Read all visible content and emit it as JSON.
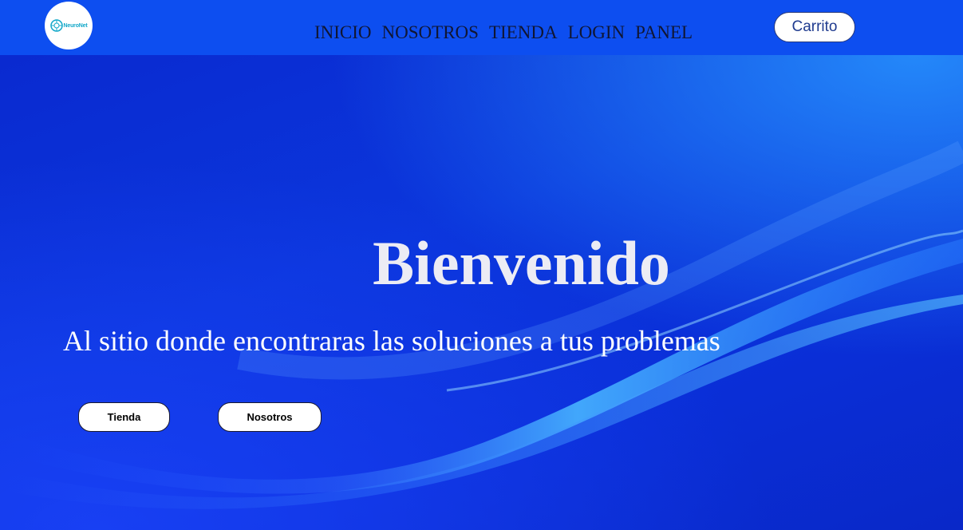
{
  "header": {
    "logo_text": "NeuroNet",
    "nav": [
      "INICIO",
      "NOSOTROS",
      "TIENDA",
      "LOGIN",
      "PANEL"
    ],
    "cart_label": "Carrito"
  },
  "hero": {
    "title": "Bienvenido",
    "subtitle": "Al sitio donde encontraras las soluciones a tus problemas",
    "buttons": [
      "Tienda",
      "Nosotros"
    ]
  },
  "colors": {
    "navbar": "#0d4ef0",
    "hero_background": "#0a2fd8",
    "accent_light": "#2896ff",
    "logo_text": "#13a8c9"
  }
}
